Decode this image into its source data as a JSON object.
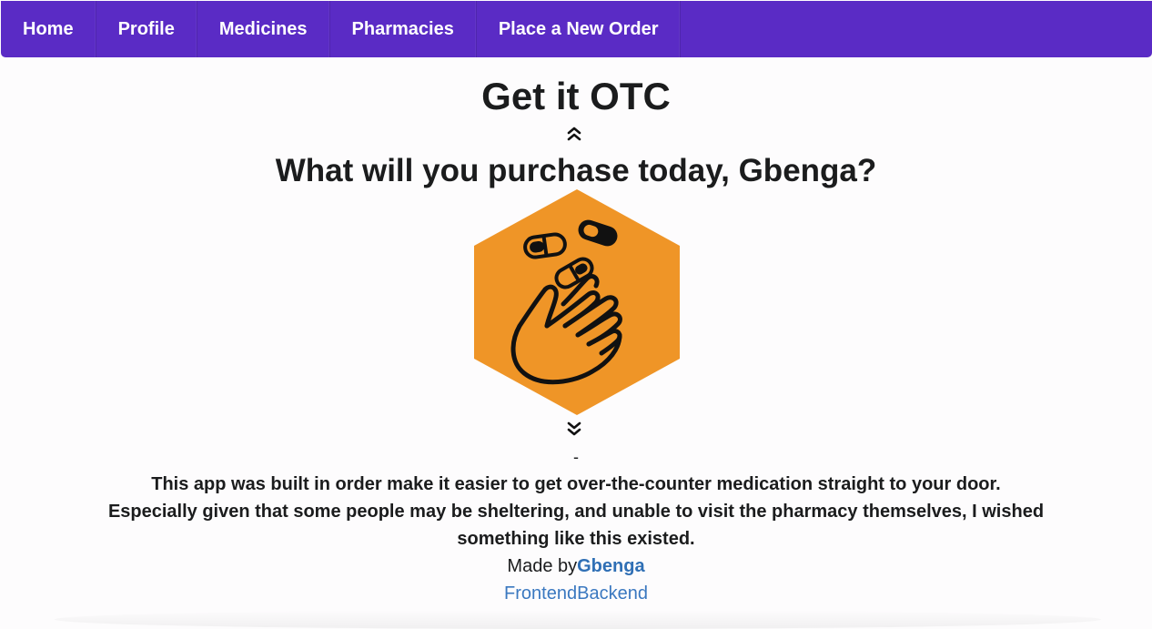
{
  "nav": {
    "items": [
      {
        "label": "Home"
      },
      {
        "label": "Profile"
      },
      {
        "label": "Medicines"
      },
      {
        "label": "Pharmacies"
      },
      {
        "label": "Place a New Order"
      }
    ]
  },
  "main": {
    "title": "Get it OTC",
    "subtitle": "What will you purchase today, Gbenga?",
    "separator": "-",
    "description_line1": "This app was built in order make it easier to get over-the-counter medication straight to your door.",
    "description_line2": "Especially given that some people may be sheltering, and unable to visit the pharmacy themselves, I wished something like this existed.",
    "made_by_prefix": "Made by",
    "author": "Gbenga",
    "link_frontend": "Frontend",
    "link_backend": "Backend"
  },
  "icons": {
    "chevron_up": "double-chevron-up-icon",
    "chevron_down": "double-chevron-down-icon",
    "hero": "hand-pills-icon"
  },
  "colors": {
    "nav_bg": "#5a2bc5",
    "hero_bg": "#ef9527",
    "link": "#3a78c0"
  }
}
